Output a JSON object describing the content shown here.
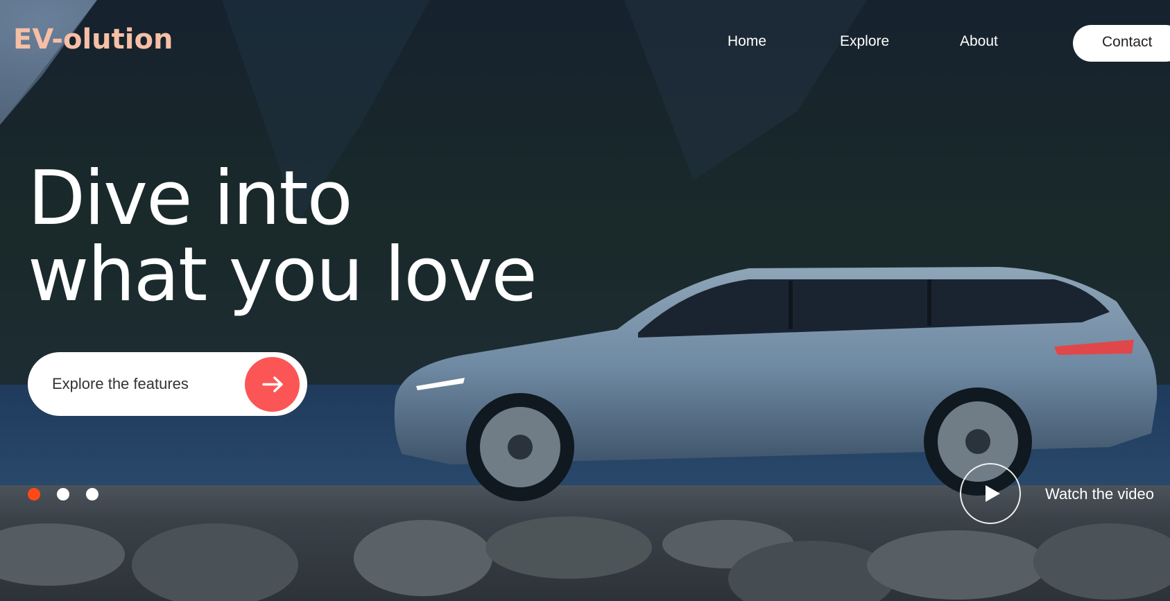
{
  "brand": {
    "logo": "EV-olution",
    "logo_color": "#f6bfa6"
  },
  "nav": {
    "items": [
      {
        "label": "Home"
      },
      {
        "label": "Explore"
      },
      {
        "label": "About"
      }
    ],
    "contact_label": "Contact"
  },
  "hero": {
    "title_line1": "Dive into",
    "title_line2": "what you love",
    "cta_label": "Explore the features",
    "cta_icon": "arrow-right-icon",
    "cta_accent": "#fb5655"
  },
  "carousel": {
    "slide_count": 3,
    "active_index": 0,
    "active_color": "#ff4a18"
  },
  "video": {
    "label": "Watch the video",
    "icon": "play-icon"
  }
}
